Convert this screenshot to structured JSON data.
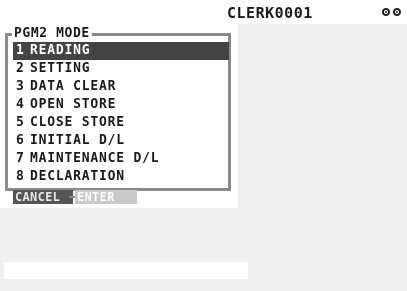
{
  "header": {
    "clerk_label": "CLERK0001",
    "status_icons": [
      "key-icon",
      "key-icon"
    ]
  },
  "menu": {
    "title": "PGM2 MODE",
    "selected_index": 0,
    "items": [
      {
        "num": "1",
        "label": "READING"
      },
      {
        "num": "2",
        "label": "SETTING"
      },
      {
        "num": "3",
        "label": "DATA CLEAR"
      },
      {
        "num": "4",
        "label": "OPEN STORE"
      },
      {
        "num": "5",
        "label": "CLOSE STORE"
      },
      {
        "num": "6",
        "label": "INITIAL D/L"
      },
      {
        "num": "7",
        "label": "MAINTENANCE D/L"
      },
      {
        "num": "8",
        "label": "DECLARATION"
      }
    ]
  },
  "softkeys": {
    "cancel_label": "CANCEL",
    "enter_label": "ENTER"
  },
  "input": {
    "value": ""
  },
  "colors": {
    "background": "#efefef",
    "panel_border": "#8a8a8a",
    "selection": "#444444",
    "cancel_key": "#555555",
    "enter_key": "#c9c9c9"
  }
}
